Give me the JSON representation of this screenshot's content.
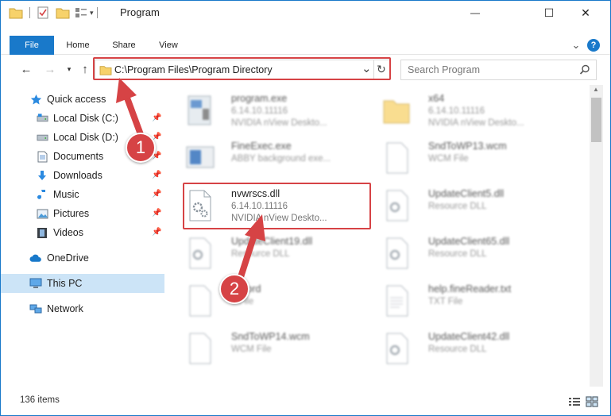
{
  "window": {
    "title": "Program",
    "minimize_glyph": "—",
    "maximize_glyph": "☐",
    "close_glyph": "✕"
  },
  "ribbon": {
    "tabs": [
      {
        "label": "File"
      },
      {
        "label": "Home"
      },
      {
        "label": "Share"
      },
      {
        "label": "View"
      }
    ],
    "help_glyph": "?",
    "collapse_glyph": "⌄"
  },
  "address": {
    "path": "C:\\Program Files\\Program Directory",
    "dropdown_glyph": "⌄",
    "refresh_glyph": "↻"
  },
  "search": {
    "placeholder": "Search Program"
  },
  "nav": {
    "items": [
      {
        "label": "Quick access"
      },
      {
        "label": "Local Disk (C:)"
      },
      {
        "label": "Local Disk (D:)"
      },
      {
        "label": "Documents"
      },
      {
        "label": "Downloads"
      },
      {
        "label": "Music"
      },
      {
        "label": "Pictures"
      },
      {
        "label": "Videos"
      },
      {
        "label": "OneDrive"
      },
      {
        "label": "This PC"
      },
      {
        "label": "Network"
      }
    ]
  },
  "files": [
    {
      "name": "program.exe",
      "line1": "6.14.10.11116",
      "line2": "NVIDIA nView Deskto..."
    },
    {
      "name": "x64",
      "line1": "6.14.10.11116",
      "line2": "NVIDIA nView Deskto..."
    },
    {
      "name": "FineExec.exe",
      "line1": "ABBY background exe...",
      "line2": ""
    },
    {
      "name": "SndToWP13.wcm",
      "line1": "WCM File",
      "line2": ""
    },
    {
      "name": "nvwrscs.dll",
      "line1": "6.14.10.11116",
      "line2": "NVIDIA nView Deskto..."
    },
    {
      "name": "UpdateClient5.dll",
      "line1": "Resource DLL",
      "line2": ""
    },
    {
      "name": "UpdateClient19.dll",
      "line1": "Resource DLL",
      "line2": ""
    },
    {
      "name": "UpdateClient65.dll",
      "line1": "Resource DLL",
      "line2": ""
    },
    {
      "name": "...word",
      "line1": "...File",
      "line2": ""
    },
    {
      "name": "help.fineReader.txt",
      "line1": "TXT File",
      "line2": ""
    },
    {
      "name": "SndToWP14.wcm",
      "line1": "WCM File",
      "line2": ""
    },
    {
      "name": "UpdateClient42.dll",
      "line1": "Resource DLL",
      "line2": ""
    }
  ],
  "status": {
    "count": "136 items"
  },
  "callouts": [
    {
      "label": "1"
    },
    {
      "label": "2"
    }
  ],
  "colors": {
    "accent": "#1979ca",
    "highlight": "#d64345",
    "selection": "#cce4f7"
  }
}
